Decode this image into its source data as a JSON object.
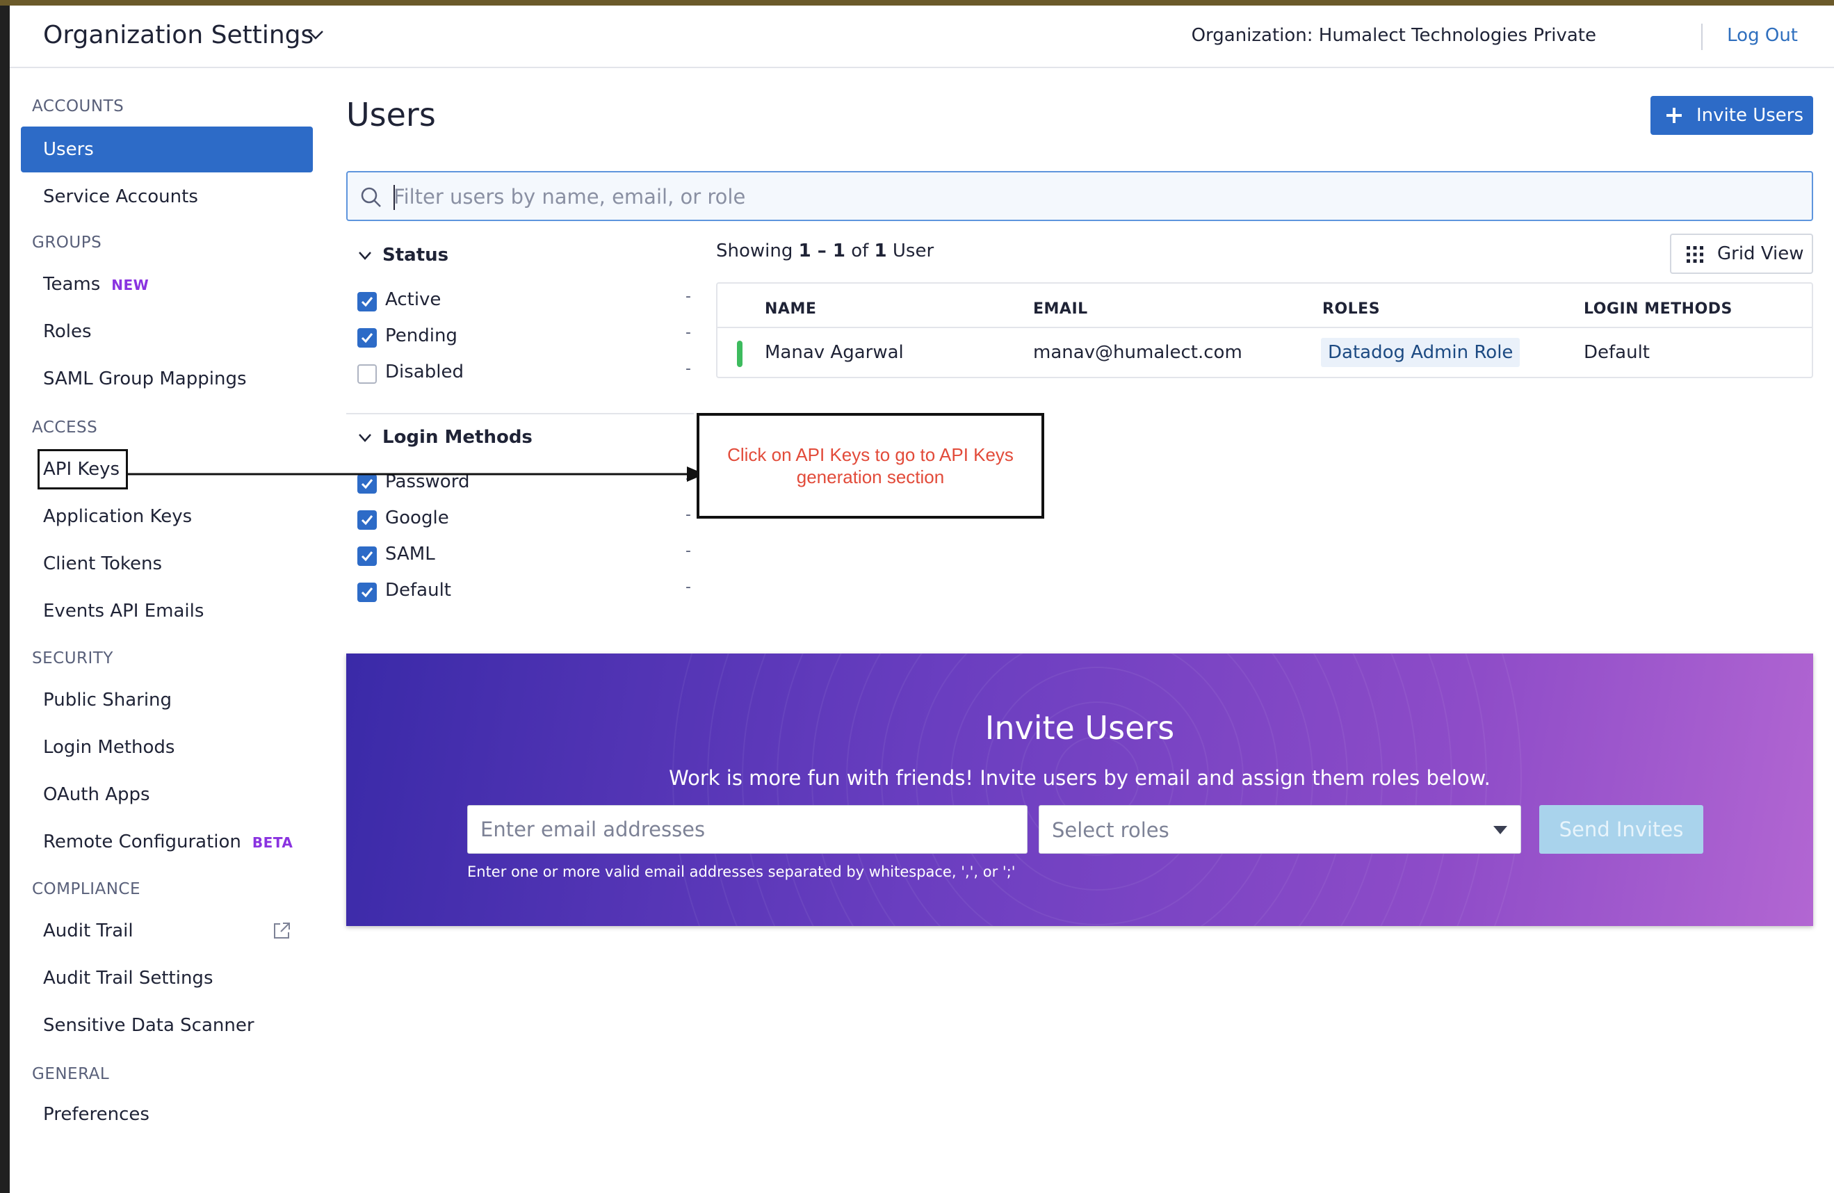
{
  "header": {
    "title": "Organization Settings",
    "organization": "Organization: Humalect Technologies Private",
    "logout": "Log Out"
  },
  "sidebar": {
    "sections": [
      {
        "label": "ACCOUNTS",
        "items": [
          {
            "label": "Users",
            "active": true
          },
          {
            "label": "Service Accounts"
          }
        ]
      },
      {
        "label": "GROUPS",
        "items": [
          {
            "label": "Teams",
            "badge": "NEW"
          },
          {
            "label": "Roles"
          },
          {
            "label": "SAML Group Mappings"
          }
        ]
      },
      {
        "label": "ACCESS",
        "items": [
          {
            "label": "API Keys"
          },
          {
            "label": "Application Keys"
          },
          {
            "label": "Client Tokens"
          },
          {
            "label": "Events API Emails"
          }
        ]
      },
      {
        "label": "SECURITY",
        "items": [
          {
            "label": "Public Sharing"
          },
          {
            "label": "Login Methods"
          },
          {
            "label": "OAuth Apps"
          },
          {
            "label": "Remote Configuration",
            "badge": "BETA"
          }
        ]
      },
      {
        "label": "COMPLIANCE",
        "items": [
          {
            "label": "Audit Trail",
            "icon": "external-link-icon"
          },
          {
            "label": "Audit Trail Settings"
          },
          {
            "label": "Sensitive Data Scanner"
          }
        ]
      },
      {
        "label": "GENERAL",
        "items": [
          {
            "label": "Preferences"
          }
        ]
      }
    ]
  },
  "main": {
    "page_title": "Users",
    "invite_button": "Invite Users",
    "search_placeholder": "Filter users by name, email, or role",
    "facets": {
      "status": {
        "title": "Status",
        "options": [
          {
            "label": "Active",
            "checked": true,
            "count": "-"
          },
          {
            "label": "Pending",
            "checked": true,
            "count": "-"
          },
          {
            "label": "Disabled",
            "checked": false,
            "count": "-"
          }
        ]
      },
      "login_methods": {
        "title": "Login Methods",
        "options": [
          {
            "label": "Password",
            "checked": true,
            "count": "-"
          },
          {
            "label": "Google",
            "checked": true,
            "count": "-"
          },
          {
            "label": "SAML",
            "checked": true,
            "count": "-"
          },
          {
            "label": "Default",
            "checked": true,
            "count": "-"
          }
        ]
      }
    },
    "showing": {
      "prefix": "Showing",
      "range": "1 – 1",
      "of": "of",
      "total": "1",
      "suffix": "User"
    },
    "grid_view_label": "Grid View",
    "table": {
      "columns": [
        "NAME",
        "EMAIL",
        "ROLES",
        "LOGIN METHODS"
      ],
      "rows": [
        {
          "name": "Manav Agarwal",
          "email": "manav@humalect.com",
          "role": "Datadog Admin Role",
          "login": "Default",
          "status_color": "#3dbb5e"
        }
      ]
    }
  },
  "annotation": {
    "text": "Click on API Keys to go to API Keys generation section",
    "color": "#e24b3a"
  },
  "invite_banner": {
    "title": "Invite Users",
    "subtitle": "Work is more fun with friends! Invite users by email and assign them roles below.",
    "email_placeholder": "Enter email addresses",
    "roles_placeholder": "Select roles",
    "send_button": "Send Invites",
    "help_text": "Enter one or more valid email addresses separated by whitespace, ',', or ';'"
  },
  "colors": {
    "accent": "#2d6bc7",
    "badge_purple": "#8a33e0",
    "link": "#2f6fbe"
  }
}
